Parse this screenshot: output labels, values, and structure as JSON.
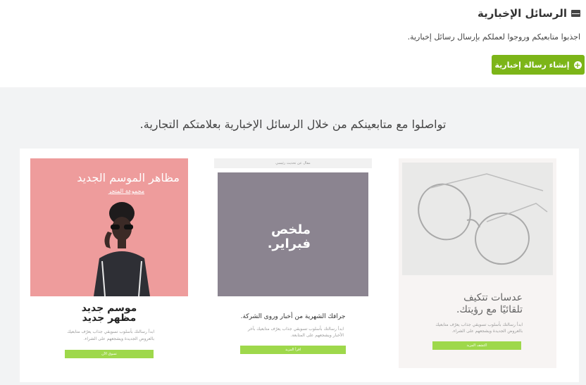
{
  "header": {
    "title": "الرسائل الإخبارية",
    "icon": "envelope-icon",
    "subtitle": "اجذبوا متابعيكم وروجوا لعملكم بإرسال رسائل إخبارية."
  },
  "create_button": {
    "label": "إنشاء رسالة إخبارية",
    "icon": "plus-circle-icon",
    "color": "#7cb518"
  },
  "promo": {
    "title": "تواصلوا مع متابعينكم من خلال الرسائل الإخبارية بعلامتكم التجارية."
  },
  "cards": [
    {
      "hero_title": "مظاهر الموسم الجديد",
      "hero_subtitle": "مجموعة المتجر",
      "title_line1": "موسم جديد",
      "title_line2": "مظهر جديد",
      "body": "ابدأ رسالتك بأسلوب تسويقي جذاب يعرّف متابعيك بالعروض الجديدة ويشجعهم على الشراء.",
      "button": "تسوق الآن"
    },
    {
      "top_bar": "مقال عن تحديث رئيسي",
      "box_line1": "ملخص",
      "box_line2": "فبراير.",
      "title": "جرافك الشهرية من أخبار وروى الشركة.",
      "body": "ابدأ رسالتك بأسلوب تسويقي جذاب يعرّف متابعيك بآخر الأخبار ويشجعهم على المتابعة.",
      "button": "اقرأ المزيد"
    },
    {
      "title_line1": "عدسات تتكيف",
      "title_line2": "تلقائيًا مع رؤيتك.",
      "body": "ابدأ رسالتك بأسلوب تسويقي جذاب يعرّف متابعيك بالعروض الجديدة ويشجعهم على الشراء.",
      "button": "اكتشف المزيد"
    }
  ]
}
